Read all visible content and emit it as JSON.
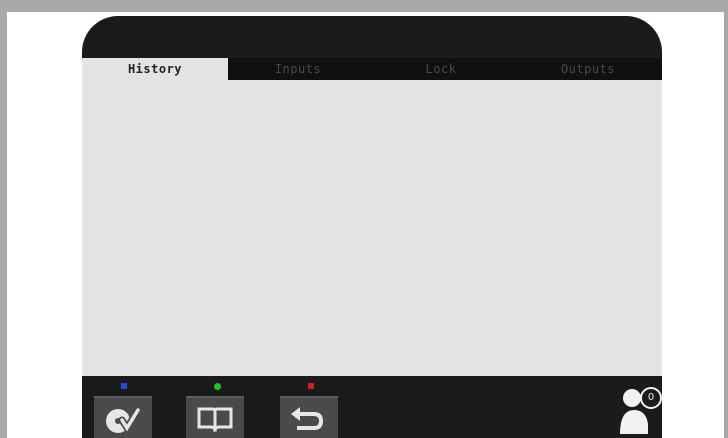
{
  "tabs": [
    {
      "label": "History",
      "active": true
    },
    {
      "label": "Inputs",
      "active": false
    },
    {
      "label": "Lock",
      "active": false
    },
    {
      "label": "Outputs",
      "active": false
    }
  ],
  "toolbar": {
    "leds": [
      {
        "name": "blue",
        "color": "#1f4fd6"
      },
      {
        "name": "green",
        "color": "#1cc42b"
      },
      {
        "name": "red",
        "color": "#d62020"
      }
    ],
    "buttons": [
      {
        "icon": "disc-check-icon"
      },
      {
        "icon": "book-icon"
      },
      {
        "icon": "undo-arrow-icon"
      }
    ]
  },
  "user": {
    "icon": "user-icon",
    "count": "0"
  },
  "colors": {
    "frame": "#a7a9ab",
    "device": "#1b1b1b",
    "panel": "#e3e3e3",
    "button": "#4a4a4a"
  }
}
